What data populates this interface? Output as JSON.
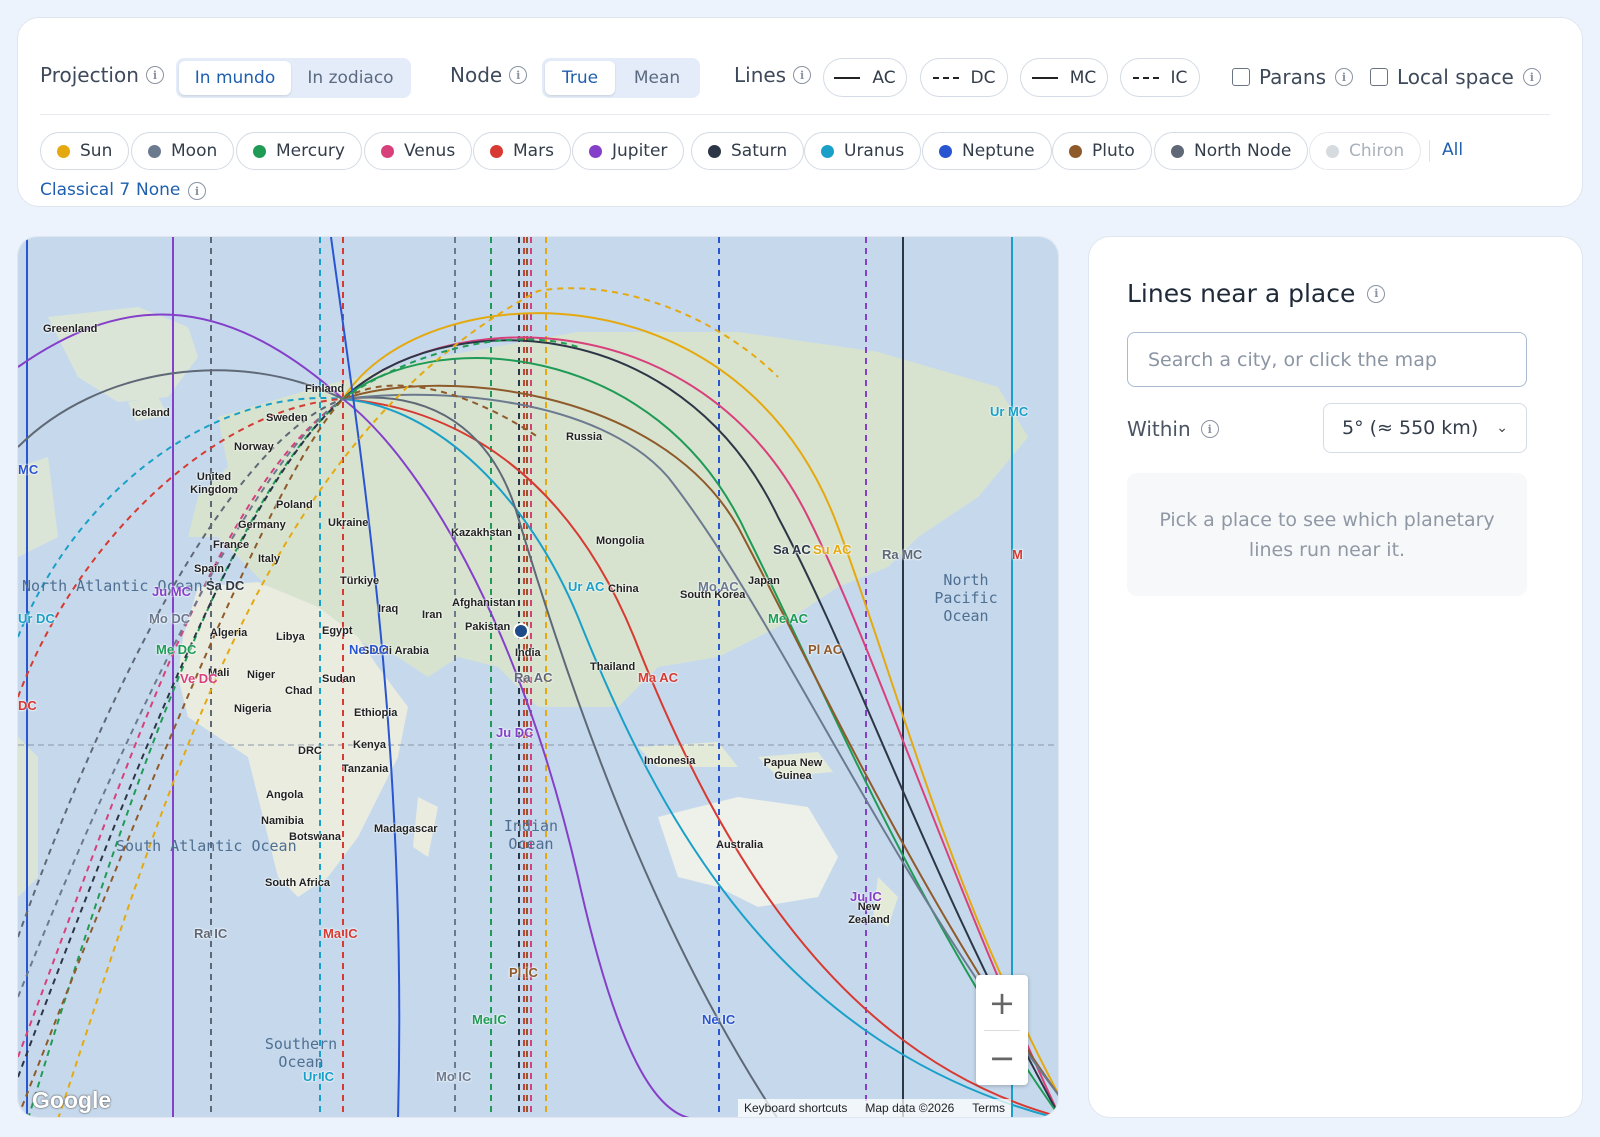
{
  "controls": {
    "projection": {
      "label": "Projection",
      "options": [
        "In mundo",
        "In zodiaco"
      ],
      "selected": "In mundo"
    },
    "node": {
      "label": "Node",
      "options": [
        "True",
        "Mean"
      ],
      "selected": "True"
    },
    "lines": {
      "label": "Lines",
      "items": [
        {
          "label": "AC",
          "style": "solid"
        },
        {
          "label": "DC",
          "style": "dashed"
        },
        {
          "label": "MC",
          "style": "solid"
        },
        {
          "label": "IC",
          "style": "dashed"
        }
      ]
    },
    "parans": {
      "label": "Parans",
      "checked": false
    },
    "local_space": {
      "label": "Local space",
      "checked": false
    },
    "planets": [
      {
        "name": "Sun",
        "color": "#e5a910",
        "enabled": true
      },
      {
        "name": "Moon",
        "color": "#6c7a90",
        "enabled": true
      },
      {
        "name": "Mercury",
        "color": "#1f9b56",
        "enabled": true
      },
      {
        "name": "Venus",
        "color": "#d8407c",
        "enabled": true
      },
      {
        "name": "Mars",
        "color": "#d63a32",
        "enabled": true
      },
      {
        "name": "Jupiter",
        "color": "#8540c9",
        "enabled": true
      },
      {
        "name": "Saturn",
        "color": "#2c3646",
        "enabled": true
      },
      {
        "name": "Uranus",
        "color": "#1aa0c8",
        "enabled": true
      },
      {
        "name": "Neptune",
        "color": "#2a55d0",
        "enabled": true
      },
      {
        "name": "Pluto",
        "color": "#8e5a2a",
        "enabled": true
      },
      {
        "name": "North Node",
        "color": "#5f6877",
        "enabled": true
      },
      {
        "name": "Chiron",
        "color": "#d6dbe0",
        "enabled": false
      }
    ],
    "presets": {
      "all": "All",
      "classical": "Classical 7",
      "none": "None"
    }
  },
  "map": {
    "places": [
      "Greenland",
      "Iceland",
      "Finland",
      "Sweden",
      "Norway",
      "United Kingdom",
      "Poland",
      "Germany",
      "Ukraine",
      "France",
      "Italy",
      "Spain",
      "Türkiye",
      "Iraq",
      "Iran",
      "Afghanistan",
      "Pakistan",
      "India",
      "Kazakhstan",
      "Russia",
      "Mongolia",
      "China",
      "South Korea",
      "Japan",
      "Thailand",
      "Indonesia",
      "Papua New Guinea",
      "Australia",
      "New Zealand",
      "Algeria",
      "Libya",
      "Egypt",
      "Saudi Arabia",
      "Mali",
      "Niger",
      "Chad",
      "Sudan",
      "Nigeria",
      "Ethiopia",
      "Kenya",
      "DRC",
      "Tanzania",
      "Angola",
      "Namibia",
      "Botswana",
      "Madagascar",
      "South Africa"
    ],
    "oceans": [
      "North Atlantic Ocean",
      "South Atlantic Ocean",
      "Indian Ocean",
      "North Pacific Ocean",
      "Southern Ocean"
    ],
    "line_labels": [
      "MC",
      "Ur MC",
      "Ju MC",
      "Sa DC",
      "Mo DC",
      "Ur DC",
      "Me DC",
      "Ve DC",
      "Ne DC",
      "DC",
      "Ur AC",
      "Mo AC",
      "Me AC",
      "Ma AC",
      "Pl AC",
      "Sa AC",
      "Su AC",
      "Ra MC",
      "Ra AC",
      "Ju DC",
      "Ju IC",
      "Ra IC",
      "Ma IC",
      "Pl IC",
      "Me IC",
      "Ne IC",
      "Ur IC",
      "Mo IC",
      "M"
    ],
    "zoom_in": "+",
    "zoom_out": "−",
    "logo": "Google",
    "keyboard_shortcuts": "Keyboard shortcuts",
    "map_data": "Map data ©2026",
    "terms": "Terms"
  },
  "side": {
    "title": "Lines near a place",
    "search_placeholder": "Search a city, or click the map",
    "within_label": "Within",
    "within_value": "5° (≈ 550 km)",
    "hint": "Pick a place to see which planetary lines run near it."
  }
}
